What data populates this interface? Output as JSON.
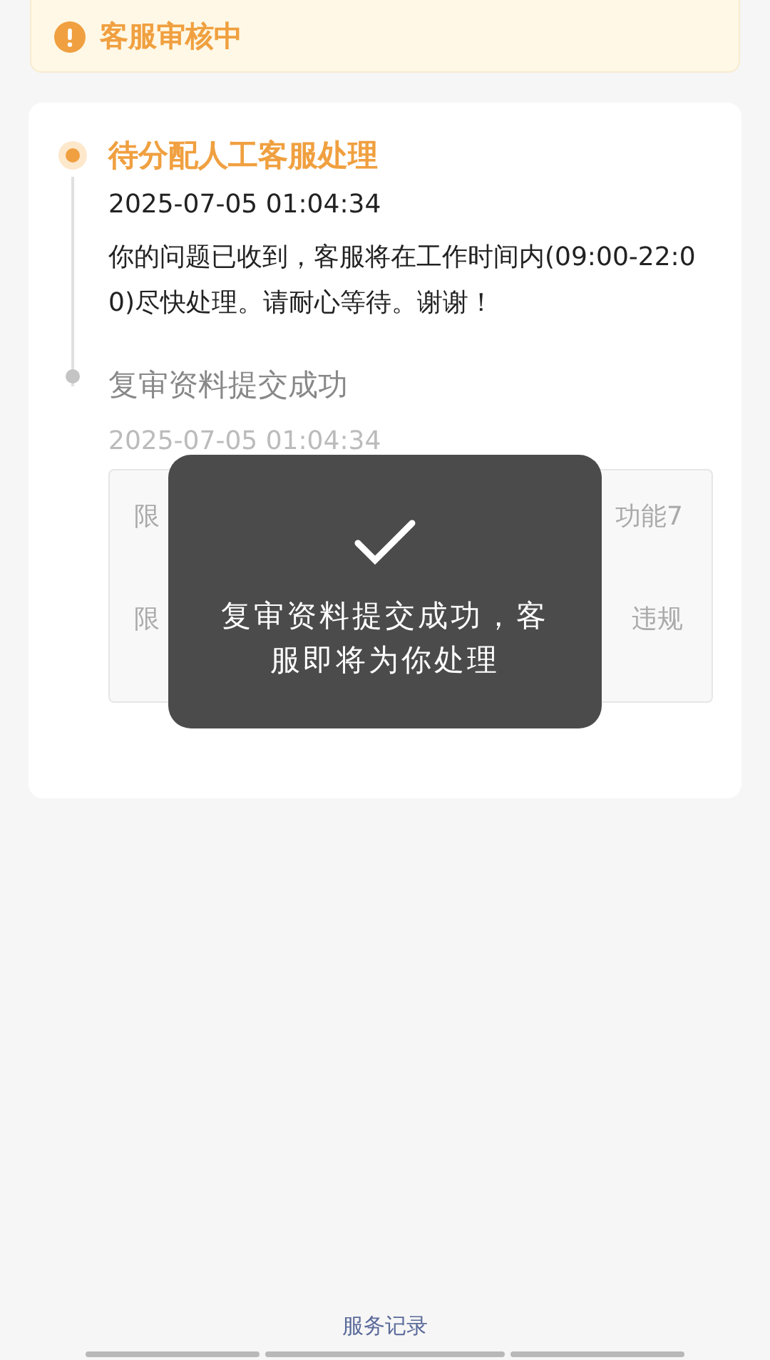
{
  "banner": {
    "text": "客服审核中"
  },
  "timeline": [
    {
      "title": "待分配人工客服处理",
      "time": "2025-07-05 01:04:34",
      "message": "你的问题已收到，客服将在工作时间内(09:00-22:00)尽快处理。请耐心等待。谢谢！",
      "active": true
    },
    {
      "title": "复审资料提交成功",
      "time": "2025-07-05 01:04:34",
      "active": false,
      "details": [
        {
          "left": "限",
          "right": "功能7"
        },
        {
          "left": "限",
          "right": "违规"
        }
      ]
    }
  ],
  "toast": {
    "message": "复审资料提交成功，客服即将为你处理"
  },
  "footer_link": "服务记录"
}
